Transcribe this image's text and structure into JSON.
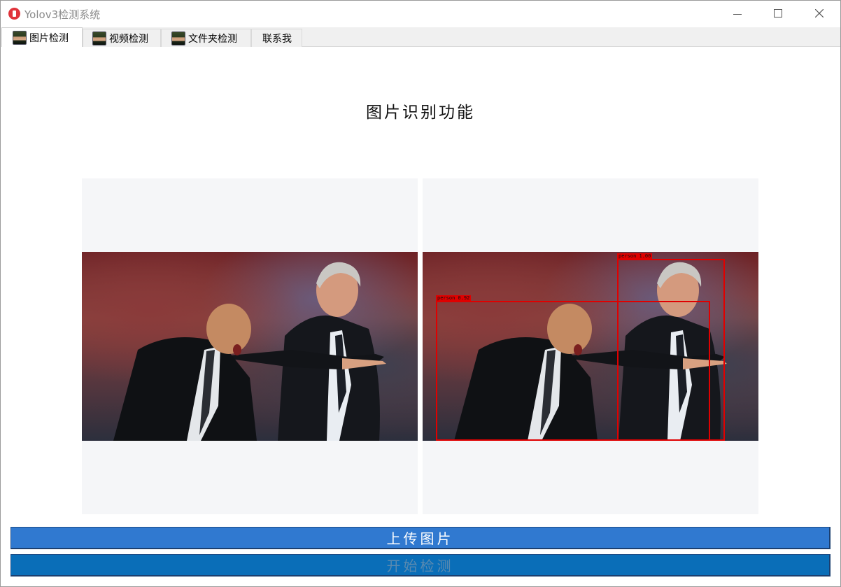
{
  "window": {
    "title": "Yolov3检测系统"
  },
  "tabs": [
    {
      "label": "图片检测",
      "has_icon": true,
      "active": true
    },
    {
      "label": "视频检测",
      "has_icon": true,
      "active": false
    },
    {
      "label": "文件夹检测",
      "has_icon": true,
      "active": false
    },
    {
      "label": "联系我",
      "has_icon": false,
      "active": false
    }
  ],
  "main": {
    "title": "图片识别功能"
  },
  "detections": [
    {
      "label": "person 1.00"
    },
    {
      "label": "person 0.92"
    }
  ],
  "buttons": {
    "upload": "上传图片",
    "start": "开始检测"
  },
  "colors": {
    "upload_button": "#3079d0",
    "start_button": "#0a6eb8",
    "box": "#e00000",
    "panel_bg": "#f5f6f8"
  }
}
